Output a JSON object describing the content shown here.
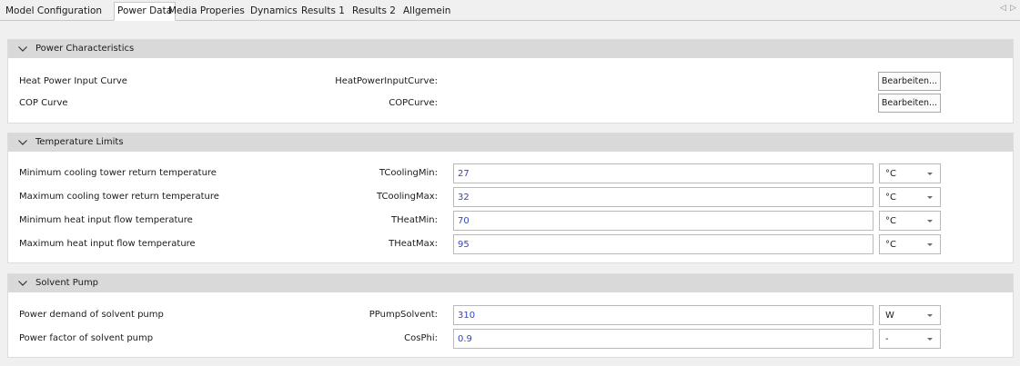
{
  "tabs": [
    {
      "label": "Model Configuration",
      "active": false
    },
    {
      "label": "Power Data",
      "active": true
    },
    {
      "label": "Media Properies",
      "active": false
    },
    {
      "label": "Dynamics",
      "active": false
    },
    {
      "label": "Results 1",
      "active": false
    },
    {
      "label": "Results 2",
      "active": false
    },
    {
      "label": "Allgemein",
      "active": false
    }
  ],
  "tab_scroll": {
    "left": "◁",
    "right": "▷"
  },
  "sections": {
    "power": {
      "title": "Power Characteristics",
      "rows": [
        {
          "label": "Heat Power Input Curve",
          "var": "HeatPowerInputCurve:",
          "button": "Bearbeiten..."
        },
        {
          "label": "COP Curve",
          "var": "COPCurve:",
          "button": "Bearbeiten..."
        }
      ]
    },
    "temperature": {
      "title": "Temperature Limits",
      "rows": [
        {
          "label": "Minimum cooling tower return temperature",
          "var": "TCoolingMin:",
          "value": "27",
          "unit": "°C"
        },
        {
          "label": "Maximum cooling tower return temperature",
          "var": "TCoolingMax:",
          "value": "32",
          "unit": "°C"
        },
        {
          "label": "Minimum heat input flow temperature",
          "var": "THeatMin:",
          "value": "70",
          "unit": "°C"
        },
        {
          "label": "Maximum heat input flow temperature",
          "var": "THeatMax:",
          "value": "95",
          "unit": "°C"
        }
      ]
    },
    "solvent": {
      "title": "Solvent Pump",
      "rows": [
        {
          "label": "Power demand of solvent pump",
          "var": "PPumpSolvent:",
          "value": "310",
          "unit": "W"
        },
        {
          "label": "Power factor of solvent pump",
          "var": "CosPhi:",
          "value": "0.9",
          "unit": "-"
        }
      ]
    }
  },
  "icons": {
    "collapse": "chevron-down-icon",
    "dropdown": "caret-down-icon"
  },
  "colors": {
    "header_bg": "#d9d9d9",
    "value_text": "#2f46c8",
    "panel_bg": "#ffffff",
    "page_bg": "#f0f0f0"
  }
}
